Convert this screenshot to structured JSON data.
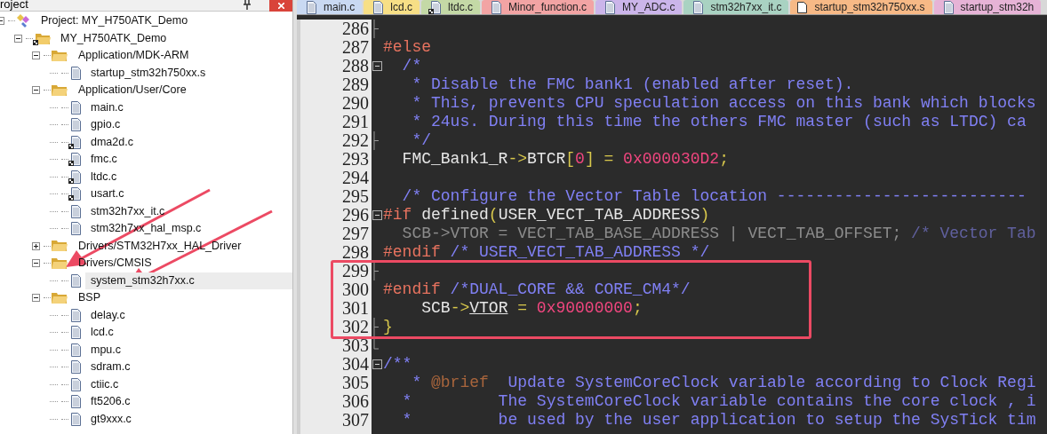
{
  "project_pane": {
    "title": "roject",
    "tree": [
      {
        "label": "Project: MY_H750ATK_Demo",
        "kind": "project",
        "expanded": true,
        "selected": false,
        "children": [
          {
            "label": "MY_H750ATK_Demo",
            "kind": "target",
            "expanded": true,
            "selected": false,
            "children": [
              {
                "label": "Application/MDK-ARM",
                "kind": "folder",
                "expanded": true,
                "selected": false,
                "children": [
                  {
                    "label": "startup_stm32h750xx.s",
                    "kind": "file",
                    "selected": false
                  }
                ]
              },
              {
                "label": "Application/User/Core",
                "kind": "folder",
                "expanded": true,
                "selected": false,
                "children": [
                  {
                    "label": "main.c",
                    "kind": "file",
                    "selected": false
                  },
                  {
                    "label": "gpio.c",
                    "kind": "file",
                    "selected": false
                  },
                  {
                    "label": "dma2d.c",
                    "kind": "file-options",
                    "selected": false
                  },
                  {
                    "label": "fmc.c",
                    "kind": "file-options",
                    "selected": false
                  },
                  {
                    "label": "ltdc.c",
                    "kind": "file-options",
                    "selected": false
                  },
                  {
                    "label": "usart.c",
                    "kind": "file-options",
                    "selected": false
                  },
                  {
                    "label": "stm32h7xx_it.c",
                    "kind": "file",
                    "selected": false
                  },
                  {
                    "label": "stm32h7xx_hal_msp.c",
                    "kind": "file",
                    "selected": false
                  }
                ]
              },
              {
                "label": "Drivers/STM32H7xx_HAL_Driver",
                "kind": "folder",
                "expanded": false,
                "selected": false
              },
              {
                "label": "Drivers/CMSIS",
                "kind": "folder",
                "expanded": true,
                "selected": false,
                "children": [
                  {
                    "label": "system_stm32h7xx.c",
                    "kind": "file",
                    "selected": true
                  }
                ]
              },
              {
                "label": "BSP",
                "kind": "folder",
                "expanded": true,
                "selected": false,
                "children": [
                  {
                    "label": "delay.c",
                    "kind": "file",
                    "selected": false
                  },
                  {
                    "label": "lcd.c",
                    "kind": "file",
                    "selected": false
                  },
                  {
                    "label": "mpu.c",
                    "kind": "file",
                    "selected": false
                  },
                  {
                    "label": "sdram.c",
                    "kind": "file",
                    "selected": false
                  },
                  {
                    "label": "ctiic.c",
                    "kind": "file",
                    "selected": false
                  },
                  {
                    "label": "ft5206.c",
                    "kind": "file",
                    "selected": false
                  },
                  {
                    "label": "gt9xxx.c",
                    "kind": "file",
                    "selected": false
                  }
                ]
              }
            ]
          }
        ]
      }
    ]
  },
  "editor_tabs": [
    {
      "label": "main.c",
      "color": "#c9d9f2",
      "kind": "file"
    },
    {
      "label": "lcd.c",
      "color": "#f7df86",
      "kind": "file"
    },
    {
      "label": "ltdc.c",
      "color": "#c4d9a6",
      "kind": "file-options"
    },
    {
      "label": "Minor_function.c",
      "color": "#f2a4a4",
      "kind": "file"
    },
    {
      "label": "MY_ADC.c",
      "color": "#cbb5ea",
      "kind": "file"
    },
    {
      "label": "stm32h7xx_it.c",
      "color": "#a9d2c2",
      "kind": "file"
    },
    {
      "label": "startup_stm32h750xx.s",
      "color": "#f7b986",
      "kind": "blank"
    },
    {
      "label": "startup_stm32h",
      "color": "#e6b3d6",
      "kind": "file"
    }
  ],
  "code_lines": [
    {
      "number": "286",
      "kind": "fold-end"
    },
    {
      "number": "287",
      "kind": "plain",
      "tokens": [
        {
          "kind": "preproc",
          "text": "#else"
        }
      ]
    },
    {
      "number": "288",
      "kind": "fold-start",
      "tokens": [
        {
          "kind": "comment",
          "text": "  /*"
        }
      ]
    },
    {
      "number": "289",
      "kind": "plain",
      "tokens": [
        {
          "kind": "comment",
          "text": "   * Disable the FMC bank1 (enabled after reset)."
        }
      ]
    },
    {
      "number": "290",
      "kind": "plain",
      "tokens": [
        {
          "kind": "comment",
          "text": "   * This, prevents CPU speculation access on this bank which blocks"
        }
      ]
    },
    {
      "number": "291",
      "kind": "plain",
      "tokens": [
        {
          "kind": "comment",
          "text": "   * 24us. During this time the others FMC master (such as LTDC) ca"
        }
      ]
    },
    {
      "number": "292",
      "kind": "fold-end",
      "tokens": [
        {
          "kind": "comment",
          "text": "   */"
        }
      ]
    },
    {
      "number": "293",
      "kind": "plain",
      "tokens": [
        {
          "kind": "plain",
          "text": "  FMC_Bank1_R"
        },
        {
          "kind": "operator",
          "text": "->"
        },
        {
          "kind": "plain",
          "text": "BTCR"
        },
        {
          "kind": "operator",
          "text": "["
        },
        {
          "kind": "number",
          "text": "0"
        },
        {
          "kind": "operator",
          "text": "] = "
        },
        {
          "kind": "number",
          "text": "0x000030D2"
        },
        {
          "kind": "operator",
          "text": ";"
        }
      ]
    },
    {
      "number": "294",
      "kind": "plain"
    },
    {
      "number": "295",
      "kind": "plain",
      "tokens": [
        {
          "kind": "comment",
          "text": "  /* Configure the Vector Table location --------------------------"
        }
      ]
    },
    {
      "number": "296",
      "kind": "fold-start",
      "tokens": [
        {
          "kind": "preproc",
          "text": "#if"
        },
        {
          "kind": "plain",
          "text": " defined"
        },
        {
          "kind": "operator",
          "text": "("
        },
        {
          "kind": "plain",
          "text": "USER_VECT_TAB_ADDRESS"
        },
        {
          "kind": "operator",
          "text": ")"
        }
      ]
    },
    {
      "number": "297",
      "kind": "plain",
      "tokens": [
        {
          "kind": "inactive",
          "text": "  SCB->VTOR = VECT_TAB_BASE_ADDRESS | VECT_TAB_OFFSET;"
        },
        {
          "kind": "inactive-comment",
          "text": " /* Vector Tab"
        }
      ]
    },
    {
      "number": "298",
      "kind": "plain",
      "tokens": [
        {
          "kind": "preproc",
          "text": "#endif"
        },
        {
          "kind": "comment",
          "text": " /* USER_VECT_TAB_ADDRESS */"
        }
      ]
    },
    {
      "number": "299",
      "kind": "fold-end"
    },
    {
      "number": "300",
      "kind": "plain",
      "tokens": [
        {
          "kind": "preproc",
          "text": "#endif"
        },
        {
          "kind": "comment",
          "text": " /*DUAL_CORE && CORE_CM4*/"
        }
      ]
    },
    {
      "number": "301",
      "kind": "plain",
      "tokens": [
        {
          "kind": "plain",
          "text": "    SCB"
        },
        {
          "kind": "operator",
          "text": "->"
        },
        {
          "kind": "underlined",
          "text": "VTOR"
        },
        {
          "kind": "operator",
          "text": " = "
        },
        {
          "kind": "number",
          "text": "0x90000000"
        },
        {
          "kind": "operator",
          "text": ";"
        }
      ]
    },
    {
      "number": "302",
      "kind": "fold-end",
      "tokens": [
        {
          "kind": "operator",
          "text": "}"
        }
      ]
    },
    {
      "number": "303",
      "kind": "fold-close"
    },
    {
      "number": "304",
      "kind": "fold-start",
      "tokens": [
        {
          "kind": "comment",
          "text": "/**"
        }
      ]
    },
    {
      "number": "305",
      "kind": "plain",
      "tokens": [
        {
          "kind": "comment",
          "text": "   * "
        },
        {
          "kind": "doc-tag",
          "text": "@brief"
        },
        {
          "kind": "comment",
          "text": "  Update SystemCoreClock variable according to Clock Regi"
        }
      ]
    },
    {
      "number": "306",
      "kind": "plain",
      "tokens": [
        {
          "kind": "comment",
          "text": "  *         The SystemCoreClock variable contains the core clock , i"
        }
      ]
    },
    {
      "number": "307",
      "kind": "plain",
      "tokens": [
        {
          "kind": "comment",
          "text": "  *         be used by the user application to setup the SysTick tim"
        }
      ]
    }
  ]
}
